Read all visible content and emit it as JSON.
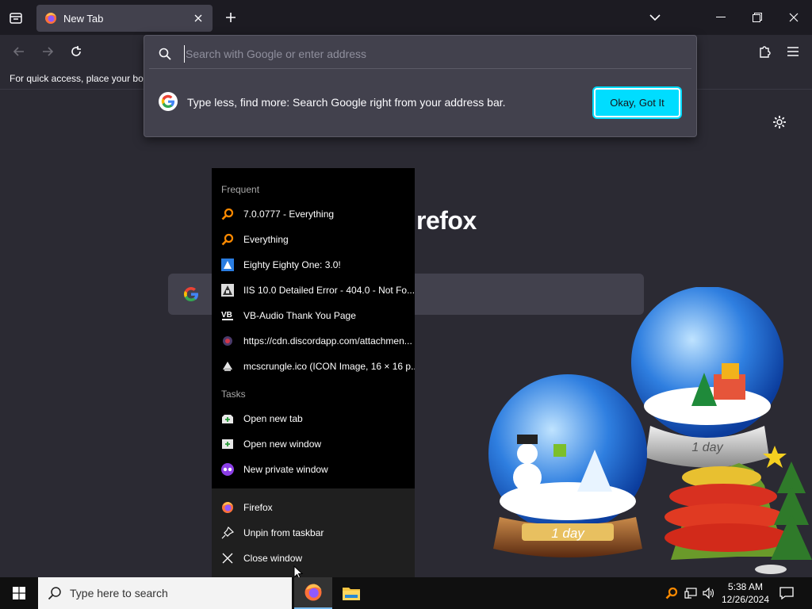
{
  "browser": {
    "tab": {
      "title": "New Tab"
    },
    "urlbar": {
      "placeholder": "Search with Google or enter address"
    },
    "bookmarks_message": "For quick access, place your boo",
    "tip": {
      "text": "Type less, find more: Search Google right from your address bar.",
      "button_label": "Okay, Got It"
    },
    "brand_text": "refox"
  },
  "jumplist": {
    "frequent_heading": "Frequent",
    "frequent": [
      {
        "label": "7.0.0777 - Everything",
        "icon": "everything-icon"
      },
      {
        "label": "Everything",
        "icon": "everything-icon"
      },
      {
        "label": "Eighty Eighty One: 3.0!",
        "icon": "site-icon"
      },
      {
        "label": "IIS 10.0 Detailed Error - 404.0 - Not Fo...",
        "icon": "iis-icon"
      },
      {
        "label": "VB-Audio Thank You Page",
        "icon": "vb-audio-icon"
      },
      {
        "label": "https://cdn.discordapp.com/attachmen...",
        "icon": "discord-icon"
      },
      {
        "label": "mcscrungle.ico (ICON Image, 16 × 16 p...",
        "icon": "image-icon"
      }
    ],
    "tasks_heading": "Tasks",
    "tasks": [
      {
        "label": "Open new tab",
        "icon": "new-tab-icon"
      },
      {
        "label": "Open new window",
        "icon": "new-window-icon"
      },
      {
        "label": "New private window",
        "icon": "private-window-icon"
      }
    ],
    "app": [
      {
        "label": "Firefox",
        "icon": "firefox-icon"
      },
      {
        "label": "Unpin from taskbar",
        "icon": "unpin-icon"
      },
      {
        "label": "Close window",
        "icon": "close-icon"
      }
    ]
  },
  "taskbar": {
    "search_placeholder": "Type here to search",
    "clock_time": "5:38 AM",
    "clock_date": "12/26/2024"
  },
  "colors": {
    "accent": "#00ddff",
    "toolbar": "#2b2a33",
    "tabstrip": "#1c1b22",
    "popup": "#42414d"
  }
}
